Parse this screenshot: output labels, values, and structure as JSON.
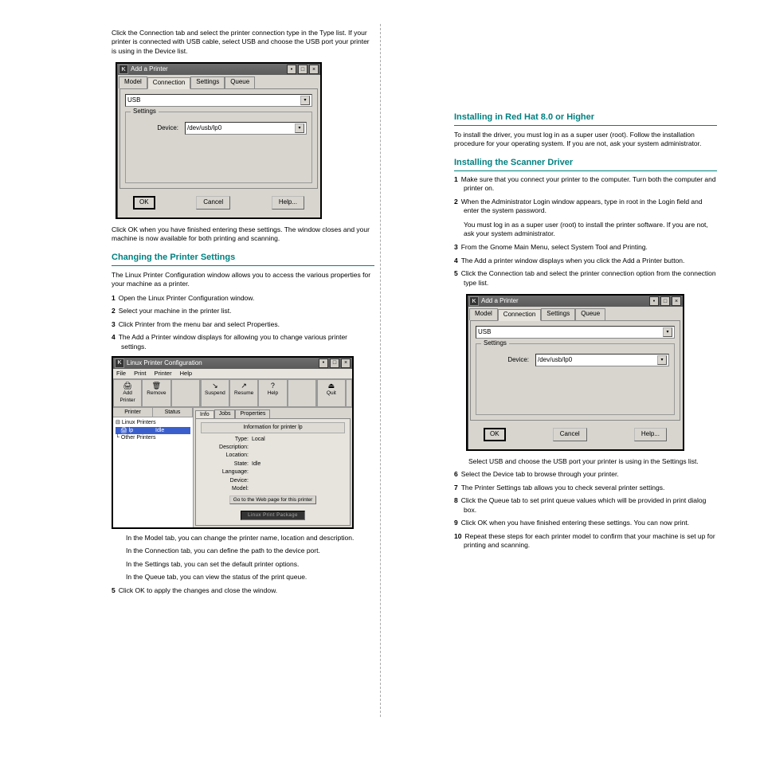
{
  "col_left": {
    "p1": "Click the Connection tab and select the printer connection type in the Type list. If your printer is connected with USB cable, select USB and choose the USB port your printer is using in the Device list.",
    "p2": "Click OK when you have finished entering these settings. The window closes and your machine is now available for both printing and scanning.",
    "h1": "Changing the Printer Settings",
    "p3": "The Linux Printer Configuration window allows you to access the various properties for your machine as a printer.",
    "step1n": "1",
    "step1": "Open the Linux Printer Configuration window.",
    "step2n": "2",
    "step2": "Select your machine in the printer list.",
    "step3n": "3",
    "step3": "Click Printer from the menu bar and select Properties.",
    "step4n": "4",
    "step4": "The Add a Printer window displays for allowing you to change various printer settings.",
    "p4a": "In the Model tab, you can change the printer name, location and description.",
    "p4b": "In the Connection tab, you can define the path to the device port.",
    "p4c": "In the Settings tab, you can set the default printer options.",
    "p4d": "In the Queue tab, you can view the status of the print queue.",
    "step5n": "5",
    "step5": "Click OK to apply the changes and close the window."
  },
  "col_right": {
    "h1": "Installing in Red Hat 8.0 or Higher",
    "p1": "To install the driver, you must log in as a super user (root). Follow the installation procedure for your operating system. If you are not, ask your system administrator.",
    "h2": "Installing the Scanner Driver",
    "step1n": "1",
    "step1": "Make sure that you connect your printer to the computer. Turn both the computer and printer on.",
    "step2n": "2",
    "step2": "When the Administrator Login window appears, type in root in the Login field and enter the system password.",
    "note": "You must log in as a super user (root) to install the printer software. If you are not, ask your system administrator.",
    "step3n": "3",
    "step3": "From the Gnome Main Menu, select System Tool and Printing.",
    "step4n": "4",
    "step4": "The Add a printer window displays when you click the Add a Printer button.",
    "step5n": "5",
    "step5": "Click the Connection tab and select the printer connection option from the connection type list.",
    "p2a": "Select USB and choose the USB port your printer is using in the Settings list.",
    "step6n": "6",
    "step6": "Select the Device tab to browse through your printer.",
    "step7n": "7",
    "step7": "The Printer Settings tab allows you to check several printer settings.",
    "step8n": "8",
    "step8": "Click the Queue tab to set print queue values which will be provided in print dialog box.",
    "step9n": "9",
    "step9": "Click OK when you have finished entering these settings. You can now print.",
    "step10n": "10",
    "step10": "Repeat these steps for each printer model to confirm that your machine is set up for printing and scanning."
  },
  "addprinter": {
    "title": "Add a Printer",
    "tabs": {
      "model": "Model",
      "connection": "Connection",
      "settings": "Settings",
      "queue": "Queue"
    },
    "type_value": "USB",
    "group": "Settings",
    "device_label": "Device:",
    "device_value": "/dev/usb/lp0",
    "ok": "OK",
    "cancel": "Cancel",
    "help": "Help..."
  },
  "configwin": {
    "title": "Linux Printer Configuration",
    "menus": {
      "file": "File",
      "print": "Print",
      "printer": "Printer",
      "help": "Help"
    },
    "toolbar": {
      "add": "Add Printer",
      "remove": "Remove",
      "suspend": "Suspend",
      "resume": "Resume",
      "help": "Help",
      "quit": "Quit"
    },
    "treehdr": {
      "printer": "Printer",
      "status": "Status"
    },
    "tree": {
      "root": "Linux Printers",
      "sel": "lp",
      "sel_status": "Idle",
      "other": "Other Printers"
    },
    "proptabs": {
      "info": "Info",
      "jobs": "Jobs",
      "props": "Properties"
    },
    "info_title": "Information for printer lp",
    "info": {
      "type_k": "Type:",
      "type_v": "Local",
      "desc_k": "Description:",
      "desc_v": "",
      "loc_k": "Location:",
      "loc_v": "",
      "state_k": "State:",
      "state_v": "Idle",
      "lang_k": "Language:",
      "lang_v": "",
      "dev_k": "Device:",
      "dev_v": "",
      "model_k": "Model:",
      "model_v": ""
    },
    "webbtn": "Go to the Web page for this printer",
    "logo": "Linux Print Package"
  },
  "winbtn": {
    "min": "–",
    "max": "□",
    "close": "×",
    "kletter": "K"
  }
}
